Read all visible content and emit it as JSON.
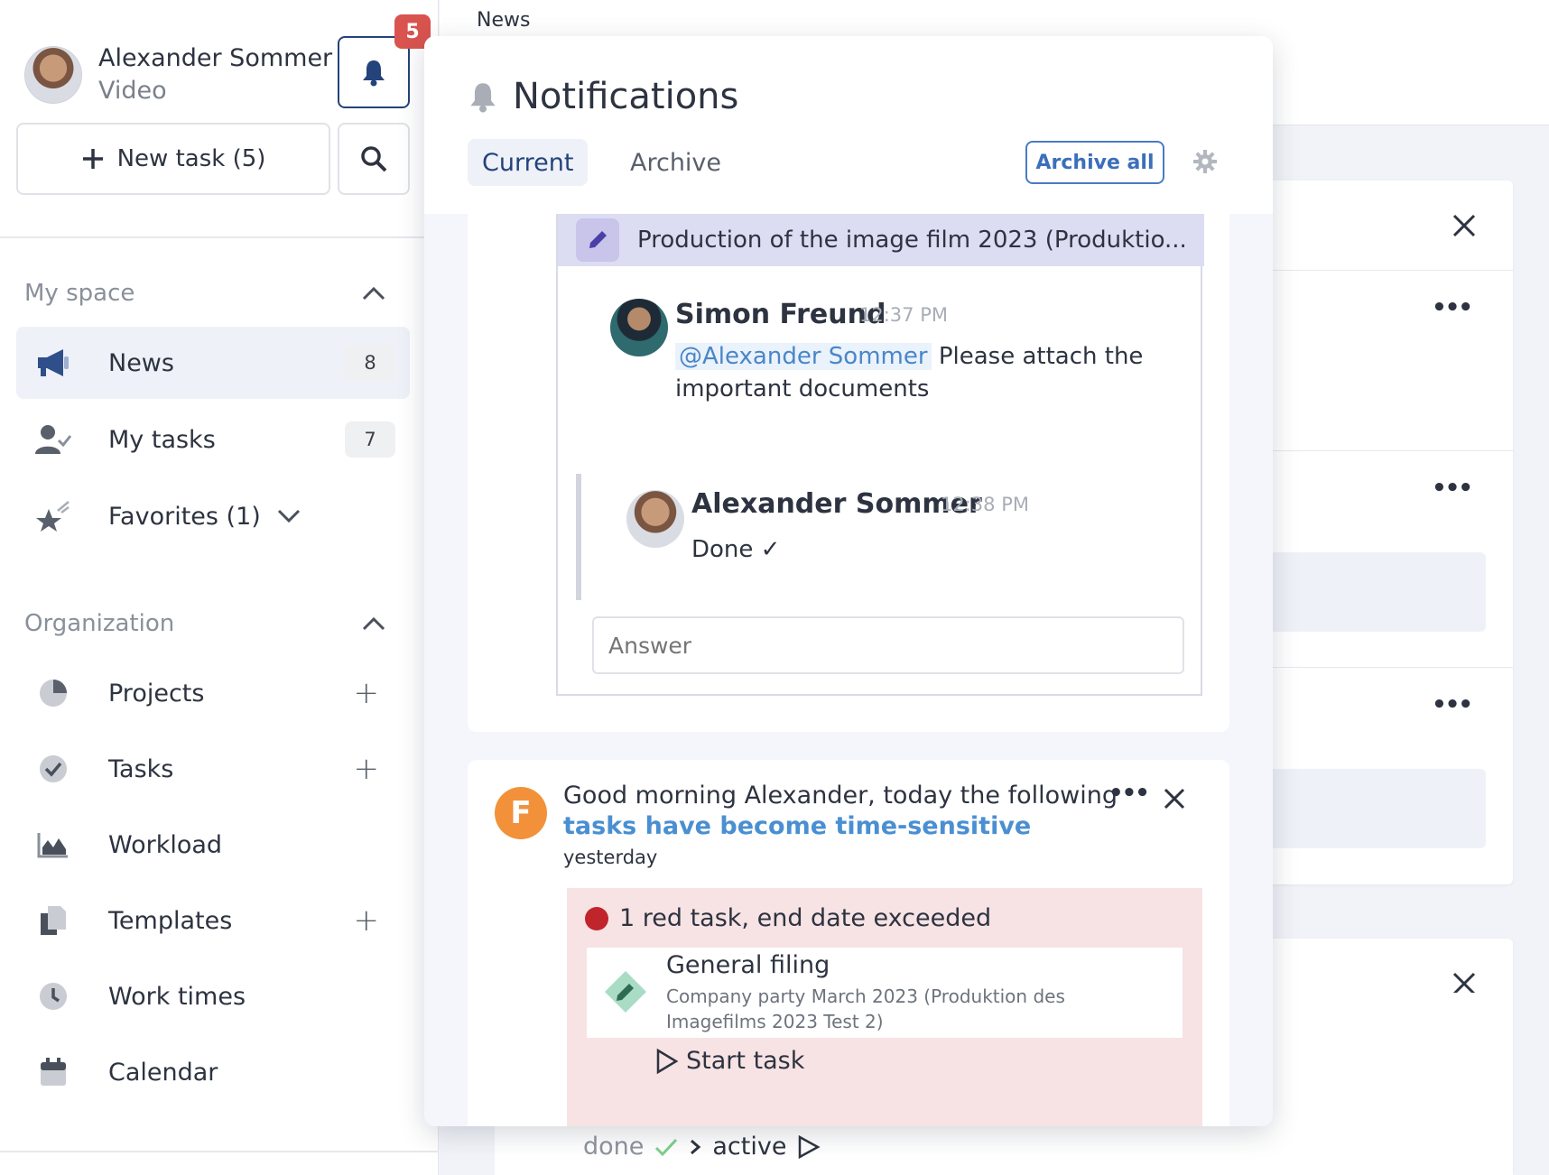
{
  "user": {
    "name": "Alexander Sommer",
    "role": "Video"
  },
  "notifications_badge": "5",
  "new_task_label": "New task (5)",
  "breadcrumb": "News",
  "sections": {
    "my_space": "My space",
    "organization": "Organization"
  },
  "my_space_items": [
    {
      "label": "News",
      "count": "8",
      "icon": "megaphone-icon",
      "active": true
    },
    {
      "label": "My tasks",
      "count": "7",
      "icon": "user-check-icon"
    },
    {
      "label": "Favorites (1)",
      "icon": "star-icon"
    }
  ],
  "organization_items": [
    {
      "label": "Projects",
      "icon": "pie-chart-icon",
      "add": true
    },
    {
      "label": "Tasks",
      "icon": "check-circle-icon",
      "add": true
    },
    {
      "label": "Workload",
      "icon": "area-chart-icon"
    },
    {
      "label": "Templates",
      "icon": "copy-icon",
      "add": true
    },
    {
      "label": "Work times",
      "icon": "clock-icon"
    },
    {
      "label": "Calendar",
      "icon": "calendar-icon"
    }
  ],
  "panel": {
    "title": "Notifications",
    "tabs": [
      "Current",
      "Archive"
    ],
    "archive_all": "Archive all"
  },
  "thread": {
    "subject": "Production of the image film 2023 (Produktio...",
    "messages": [
      {
        "author": "Simon Freund",
        "time": "12:37 PM",
        "mention": "@Alexander Sommer",
        "text_line1": "Please attach the",
        "text_line2": "important documents"
      },
      {
        "author": "Alexander Sommer",
        "time": "12:38 PM",
        "text": "Done ✓"
      }
    ],
    "answer_placeholder": "Answer"
  },
  "digest": {
    "text": "Good morning Alexander, today the following",
    "link": "tasks have become time-sensitive",
    "time": "yesterday",
    "red_heading": "1 red task, end date exceeded",
    "task_title": "General filing",
    "task_project": "Company party March 2023 (Produktion des Imagefilms 2023 Test 2)",
    "start_label": "Start task"
  },
  "status": {
    "done": "done",
    "active": "active"
  },
  "colors": {
    "accent": "#24437a",
    "link": "#4a8fd1",
    "badge": "#d9534f",
    "red": "#c0252b",
    "logo": "#f2913a"
  }
}
